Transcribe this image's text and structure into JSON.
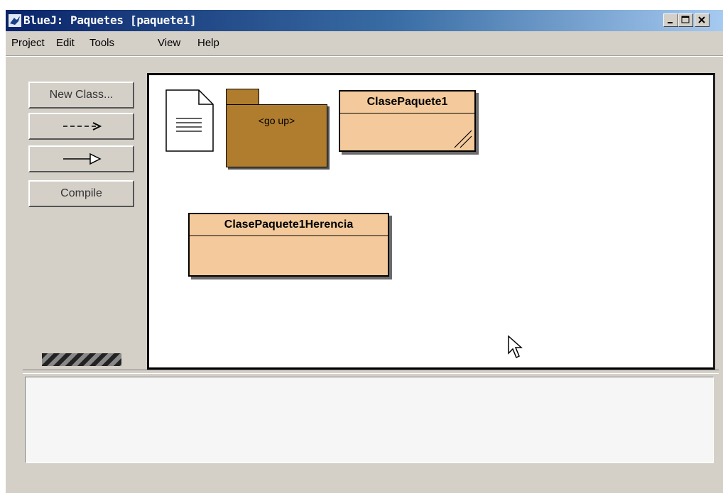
{
  "window": {
    "app": "BlueJ:",
    "title": "Paquetes [paquete1]",
    "controls": [
      "minimize",
      "maximize",
      "close"
    ]
  },
  "menu": [
    "Project",
    "Edit",
    "Tools",
    "View",
    "Help"
  ],
  "toolbar": {
    "new_class": "New Class...",
    "dependency_arrow": "--->",
    "inheritance_arrow": "——▷",
    "compile": "Compile"
  },
  "diagram": {
    "package_up_label": "<go up>",
    "classes": [
      {
        "name": "ClasePaquete1",
        "selected": true
      },
      {
        "name": "ClasePaquete1Herencia",
        "selected": false
      }
    ]
  },
  "colors": {
    "class_fill": "#f4ca9c",
    "package_fill": "#b07d2f",
    "title_gradient_start": "#0a246a"
  },
  "message_area": ""
}
